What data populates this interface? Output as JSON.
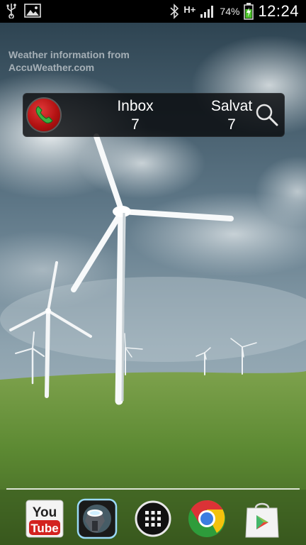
{
  "status_bar": {
    "network_type": "H+",
    "battery_percent": "74%",
    "battery_level": 0.74,
    "time": "12:24",
    "icons": [
      "usb-icon",
      "image-icon",
      "bluetooth-icon",
      "signal-icon",
      "battery-charging-icon"
    ]
  },
  "weather_attribution": {
    "line1": "Weather information from",
    "line2": "AccuWeather.com"
  },
  "widget": {
    "inbox_label": "Inbox",
    "inbox_count": "7",
    "saved_label": "Salvat",
    "saved_count": "7",
    "call_icon": "phone-icon",
    "search_icon": "search-icon"
  },
  "dock": {
    "youtube_logo_top": "You",
    "youtube_logo_bottom": "Tube",
    "apps": [
      "youtube-icon",
      "flashlight-icon",
      "app-drawer-icon",
      "chrome-icon",
      "play-store-icon"
    ]
  },
  "colors": {
    "widget_bg": "#0a0c0e",
    "call_button": "#c21818",
    "grass": "#5f8a35",
    "sky": "#6d8595"
  }
}
